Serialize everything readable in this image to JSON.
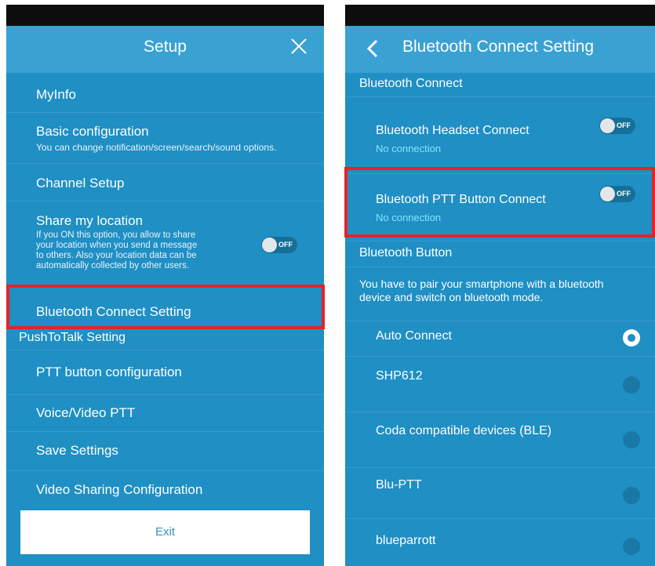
{
  "left": {
    "title": "Setup",
    "items": [
      {
        "label": "MyInfo"
      },
      {
        "label": "Basic configuration",
        "sub": "You can change notification/screen/search/sound options."
      },
      {
        "label": "Channel Setup"
      },
      {
        "label": "Share my location",
        "sub1": "If you ON this option, you allow to share",
        "sub2": "your location when you send a message",
        "sub3": "to others. Also your location data can be",
        "sub4": "automatically collected by other users.",
        "toggle": "OFF"
      },
      {
        "label": "Bluetooth Connect Setting"
      }
    ],
    "section": "PushToTalk Setting",
    "ptt_items": [
      {
        "label": "PTT button configuration"
      },
      {
        "label": "Voice/Video PTT"
      },
      {
        "label": "Save Settings"
      },
      {
        "label": "Video Sharing Configuration"
      }
    ],
    "exit_label": "Exit"
  },
  "right": {
    "title": "Bluetooth Connect Setting",
    "section1": "Bluetooth Connect",
    "headset": {
      "label": "Bluetooth Headset Connect",
      "status": "No connection",
      "toggle": "OFF"
    },
    "ptt": {
      "label": "Bluetooth PTT Button Connect",
      "status": "No connection",
      "toggle": "OFF"
    },
    "section2": "Bluetooth Button",
    "info1": "You have to pair your smartphone with a bluetooth",
    "info2": "device and switch on bluetooth mode.",
    "devices": [
      {
        "label": "Auto Connect",
        "selected": true
      },
      {
        "label": "SHP612",
        "selected": false
      },
      {
        "label": "Coda compatible devices (BLE)",
        "selected": false
      },
      {
        "label": "Blu-PTT",
        "selected": false
      },
      {
        "label": "blueparrott",
        "selected": false
      }
    ]
  },
  "colors": {
    "background": "#1f8fc4",
    "titlebar": "#3aa1d3",
    "highlight": "#e52329",
    "status_text": "#7fe6ff"
  }
}
